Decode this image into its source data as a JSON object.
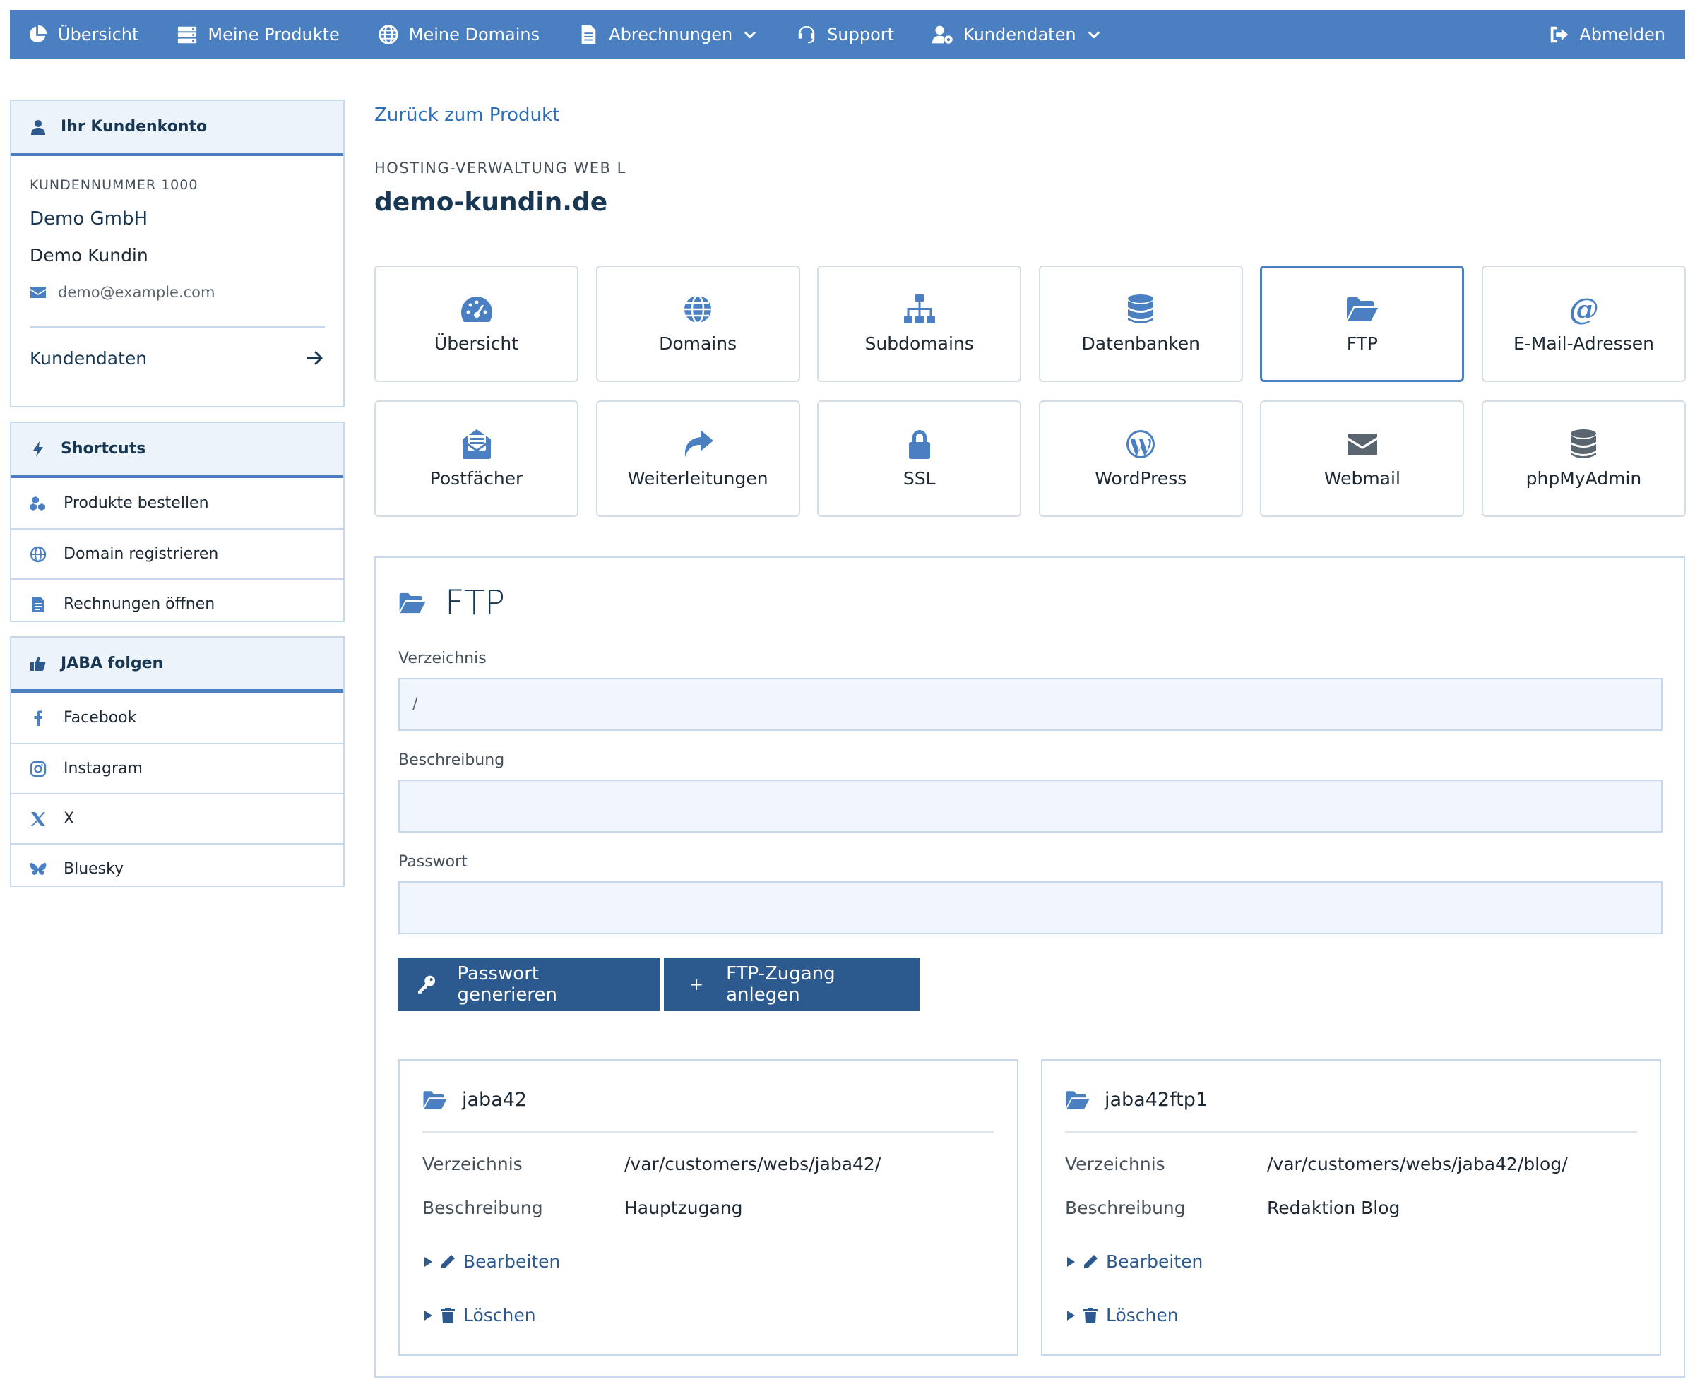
{
  "nav": {
    "items": [
      {
        "label": "Übersicht",
        "icon": "pie-chart-icon"
      },
      {
        "label": "Meine Produkte",
        "icon": "server-icon"
      },
      {
        "label": "Meine Domains",
        "icon": "globe-icon"
      },
      {
        "label": "Abrechnungen",
        "icon": "document-icon",
        "dropdown": true
      },
      {
        "label": "Support",
        "icon": "headset-icon"
      },
      {
        "label": "Kundendaten",
        "icon": "user-gear-icon",
        "dropdown": true
      }
    ],
    "logout": "Abmelden"
  },
  "account": {
    "header": "Ihr Kundenkonto",
    "customer_number": "KUNDENNUMMER 1000",
    "company": "Demo GmbH",
    "name": "Demo Kundin",
    "email": "demo@example.com",
    "link": "Kundendaten"
  },
  "shortcuts": {
    "header": "Shortcuts",
    "items": [
      {
        "label": "Produkte bestellen",
        "icon": "cubes-icon"
      },
      {
        "label": "Domain registrieren",
        "icon": "globe-icon"
      },
      {
        "label": "Rechnungen öffnen",
        "icon": "invoice-icon"
      }
    ]
  },
  "follow": {
    "header": "JABA folgen",
    "items": [
      {
        "label": "Facebook",
        "icon": "facebook-icon"
      },
      {
        "label": "Instagram",
        "icon": "instagram-icon"
      },
      {
        "label": "X",
        "icon": "x-icon"
      },
      {
        "label": "Bluesky",
        "icon": "bluesky-icon"
      }
    ]
  },
  "main": {
    "back_link": "Zurück zum Produkt",
    "eyebrow": "HOSTING-VERWALTUNG WEB L",
    "title": "demo-kundin.de",
    "tiles": [
      {
        "label": "Übersicht",
        "icon": "speedometer-icon"
      },
      {
        "label": "Domains",
        "icon": "globe-icon"
      },
      {
        "label": "Subdomains",
        "icon": "sitemap-icon"
      },
      {
        "label": "Datenbanken",
        "icon": "database-icon"
      },
      {
        "label": "FTP",
        "icon": "folder-open-icon",
        "active": true
      },
      {
        "label": "E-Mail-Adressen",
        "icon": "at-icon"
      },
      {
        "label": "Postfächer",
        "icon": "mailbox-icon"
      },
      {
        "label": "Weiterleitungen",
        "icon": "share-icon"
      },
      {
        "label": "SSL",
        "icon": "lock-icon"
      },
      {
        "label": "WordPress",
        "icon": "wordpress-icon"
      },
      {
        "label": "Webmail",
        "icon": "envelope-icon"
      },
      {
        "label": "phpMyAdmin",
        "icon": "database-icon"
      }
    ]
  },
  "ftp": {
    "title": "FTP",
    "fields": {
      "directory_label": "Verzeichnis",
      "directory_value": "/",
      "description_label": "Beschreibung",
      "description_value": "",
      "password_label": "Passwort",
      "password_value": ""
    },
    "buttons": {
      "generate": "Passwort generieren",
      "create_plus": "+",
      "create": "FTP-Zugang anlegen"
    },
    "accounts": [
      {
        "name": "jaba42",
        "directory_label": "Verzeichnis",
        "directory": "/var/customers/webs/jaba42/",
        "description_label": "Beschreibung",
        "description": "Hauptzugang",
        "edit": "Bearbeiten",
        "delete": "Löschen"
      },
      {
        "name": "jaba42ftp1",
        "directory_label": "Verzeichnis",
        "directory": "/var/customers/webs/jaba42/blog/",
        "description_label": "Beschreibung",
        "description": "Redaktion Blog",
        "edit": "Bearbeiten",
        "delete": "Löschen"
      }
    ]
  },
  "colors": {
    "nav_bg": "#4a7fc1",
    "accent": "#4a7fc1",
    "button_bg": "#2c5a8e",
    "heading": "#183753",
    "input_bg": "#f1f6fc",
    "border": "#c7d8ec"
  }
}
